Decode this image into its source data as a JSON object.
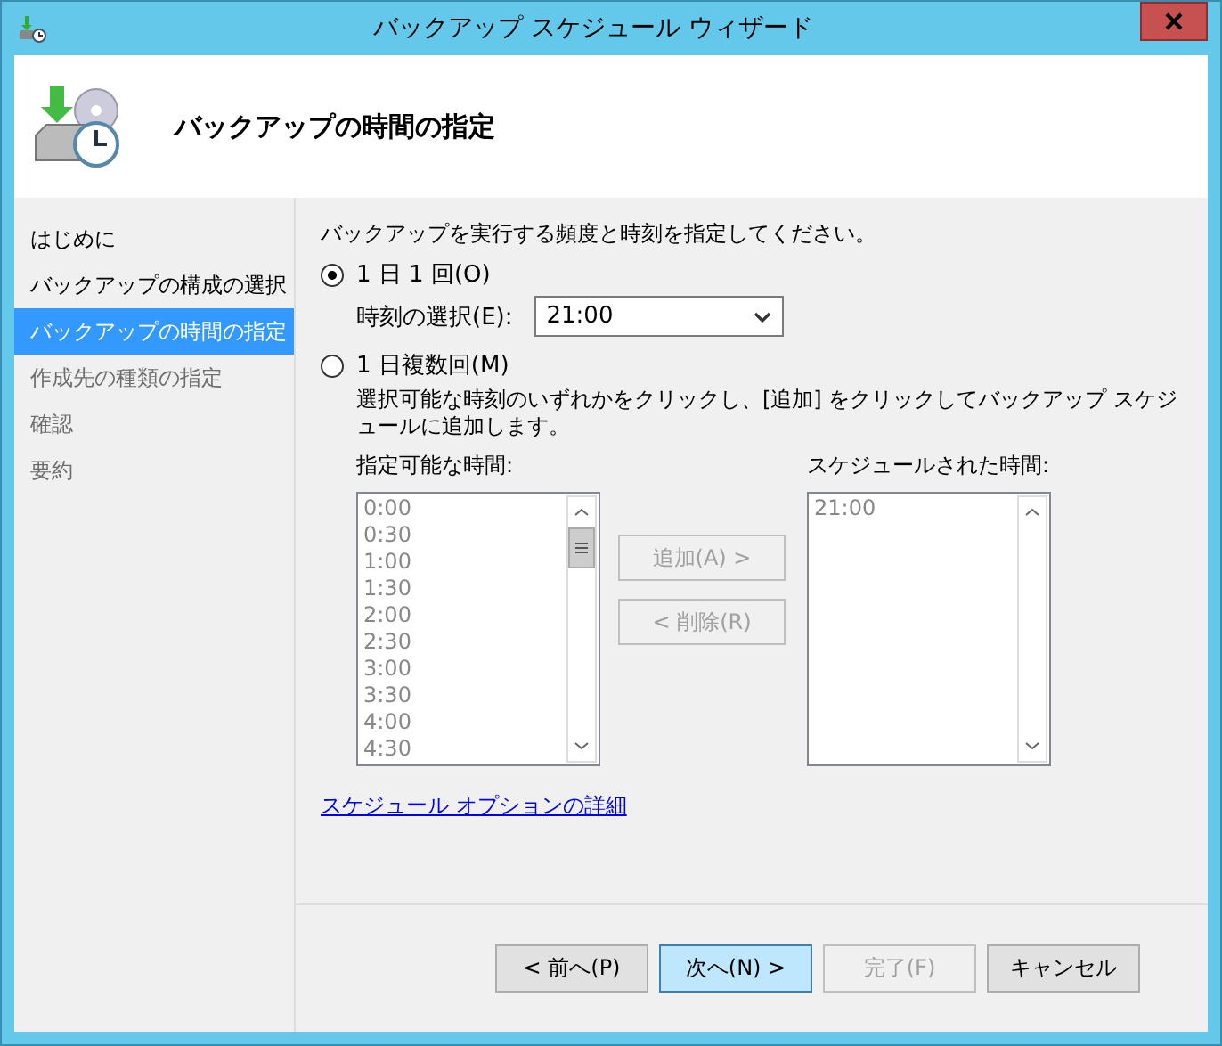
{
  "window": {
    "title": "バックアップ スケジュール ウィザード"
  },
  "header": {
    "title": "バックアップの時間の指定"
  },
  "steps": [
    {
      "label": "はじめに",
      "selected": false,
      "disabled": false
    },
    {
      "label": "バックアップの構成の選択",
      "selected": false,
      "disabled": false
    },
    {
      "label": "バックアップの時間の指定",
      "selected": true,
      "disabled": false
    },
    {
      "label": "作成先の種類の指定",
      "selected": false,
      "disabled": true
    },
    {
      "label": "確認",
      "selected": false,
      "disabled": true
    },
    {
      "label": "要約",
      "selected": false,
      "disabled": true
    }
  ],
  "instruction": "バックアップを実行する頻度と時刻を指定してください。",
  "options": [
    {
      "label": "1 日 1 回(O)",
      "selected": true
    },
    {
      "label": "1 日複数回(M)",
      "selected": false
    }
  ],
  "time_select": {
    "label": "時刻の選択(E):",
    "value": "21:00"
  },
  "multi_hint": "選択可能な時刻のいずれかをクリックし、[追加] をクリックしてバックアップ スケジュールに追加します。",
  "available": {
    "label": "指定可能な時間:",
    "disabled": true,
    "items": [
      "0:00",
      "0:30",
      "1:00",
      "1:30",
      "2:00",
      "2:30",
      "3:00",
      "3:30",
      "4:00",
      "4:30"
    ]
  },
  "scheduled": {
    "label": "スケジュールされた時間:",
    "disabled": true,
    "items": [
      "21:00"
    ]
  },
  "move_buttons": [
    {
      "label": "追加(A) >",
      "disabled": true
    },
    {
      "label": "< 削除(R)",
      "disabled": true
    }
  ],
  "link": "スケジュール オプションの詳細",
  "buttons": [
    {
      "label": "< 前へ(P)",
      "disabled": false,
      "default": false
    },
    {
      "label": "次へ(N) >",
      "disabled": false,
      "default": true
    },
    {
      "label": "完了(F)",
      "disabled": true,
      "default": false
    },
    {
      "label": "キャンセル",
      "disabled": false,
      "default": false
    }
  ]
}
